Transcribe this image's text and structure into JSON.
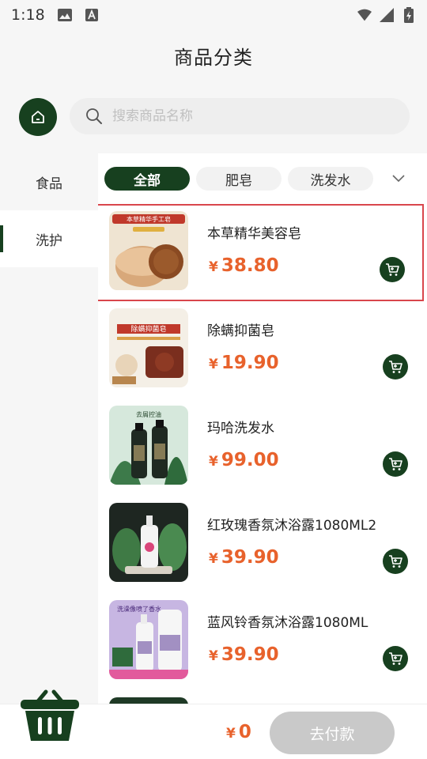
{
  "status_bar": {
    "time": "1:18"
  },
  "header": {
    "title": "商品分类"
  },
  "search": {
    "placeholder": "搜索商品名称"
  },
  "sidebar": {
    "items": [
      {
        "label": "食品"
      },
      {
        "label": "洗护"
      }
    ]
  },
  "tabs": {
    "items": [
      {
        "label": "全部"
      },
      {
        "label": "肥皂"
      },
      {
        "label": "洗发水"
      }
    ]
  },
  "currency": "¥",
  "products": [
    {
      "name": "本草精华美容皂",
      "price": "38.80",
      "thumb_text": "本草精华手工皂"
    },
    {
      "name": "除螨抑菌皂",
      "price": "19.90",
      "thumb_text": "除螨抑菌皂"
    },
    {
      "name": "玛哈洗发水",
      "price": "99.00",
      "thumb_text": "去屑控油"
    },
    {
      "name": "红玫瑰香氛沐浴露1080ML2",
      "price": "39.90",
      "thumb_text": ""
    },
    {
      "name": "蓝风铃香氛沐浴露1080ML",
      "price": "39.90",
      "thumb_text": "洗澡像喷了香水"
    }
  ],
  "bottom": {
    "total": "0",
    "pay_label": "去付款"
  },
  "colors": {
    "primary": "#17401f",
    "price": "#e8622c",
    "highlight": "#d9464c"
  }
}
